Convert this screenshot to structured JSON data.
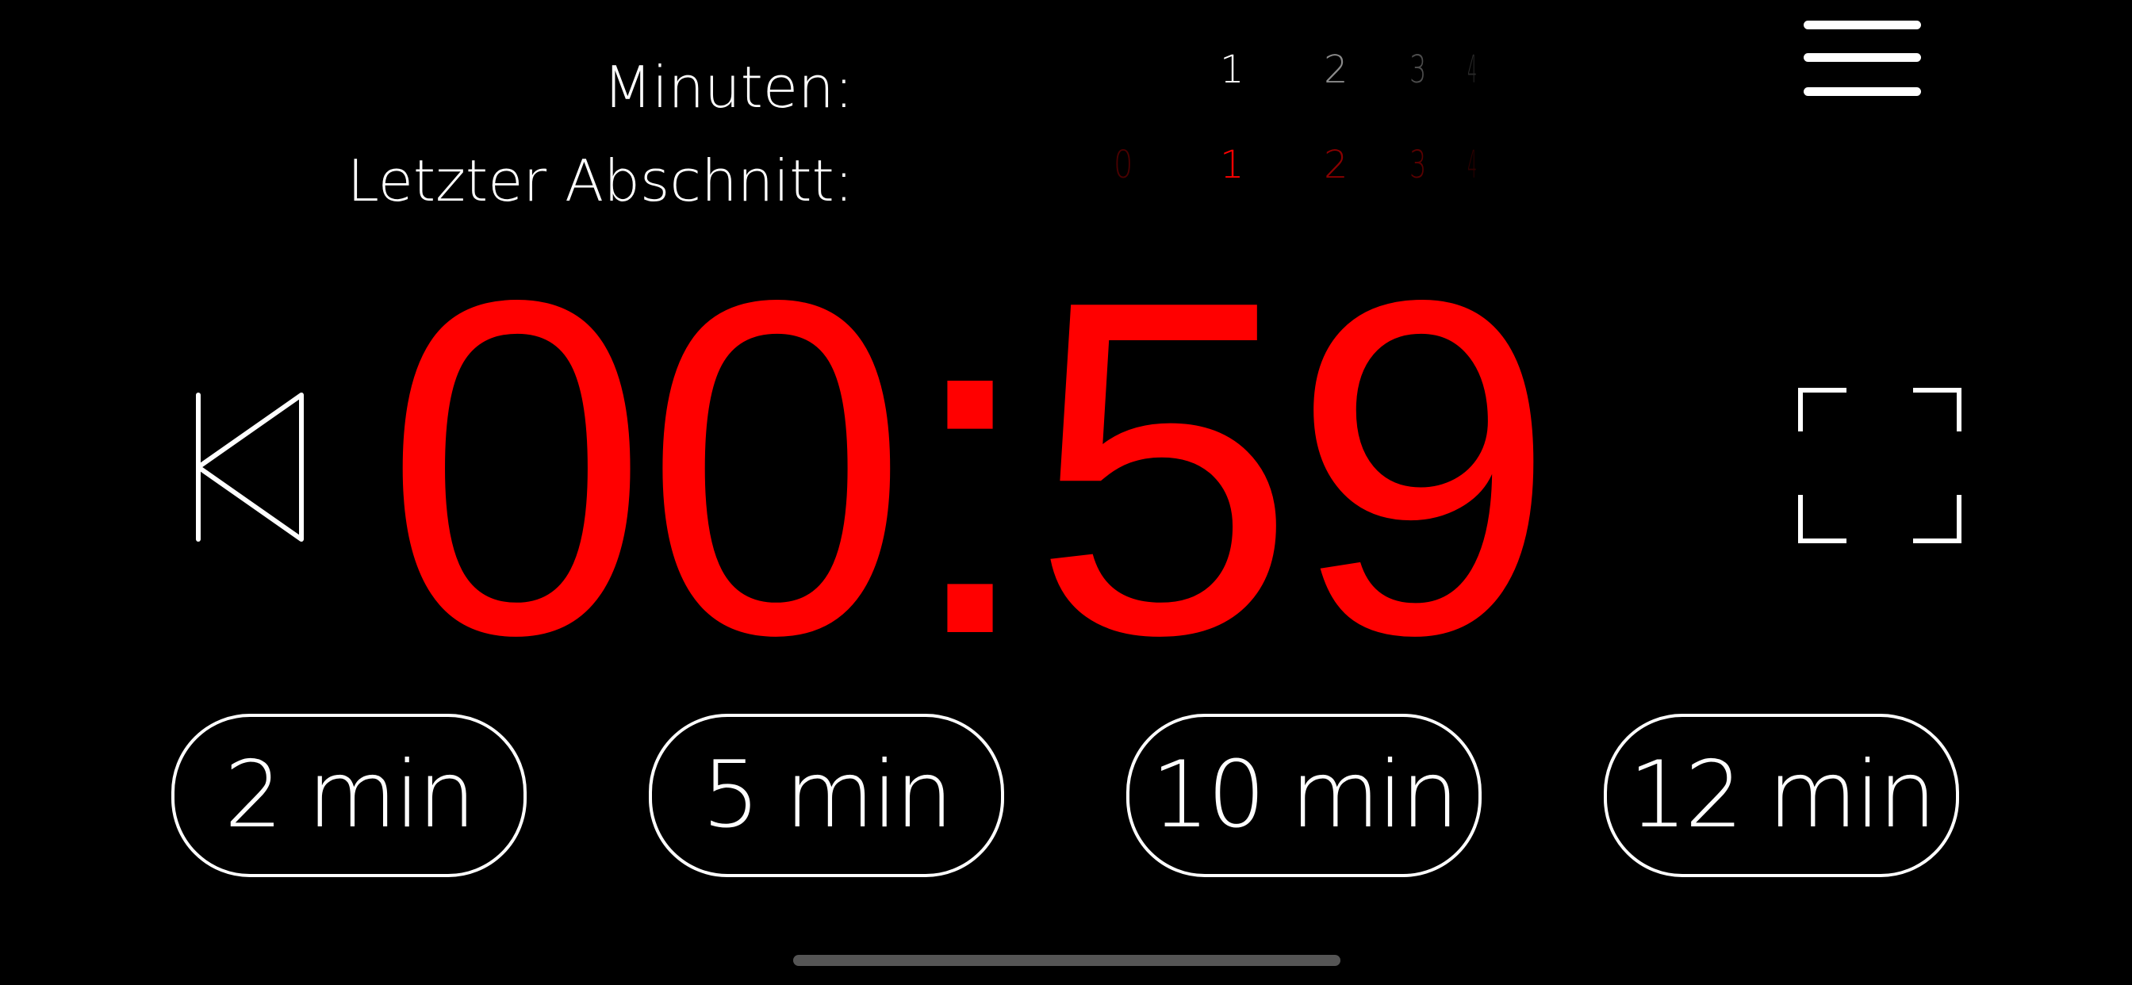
{
  "header": {
    "minutes_label": "Minuten:",
    "last_section_label": "Letzter Abschnitt:"
  },
  "minutes_picker": {
    "values": [
      "1",
      "2",
      "3",
      "4"
    ],
    "selected": "1"
  },
  "last_section_picker": {
    "values": [
      "0",
      "1",
      "2",
      "3",
      "4"
    ],
    "selected": "1"
  },
  "timer": {
    "display": "00:59"
  },
  "presets": [
    {
      "label": "2 min"
    },
    {
      "label": "5 min"
    },
    {
      "label": "10 min"
    },
    {
      "label": "12 min"
    }
  ],
  "icons": {
    "menu": "hamburger-menu-icon",
    "reset": "skip-back-icon",
    "fullscreen": "fullscreen-icon"
  },
  "colors": {
    "background": "#000000",
    "timer": "#ff0000",
    "foreground": "#ffffff"
  }
}
